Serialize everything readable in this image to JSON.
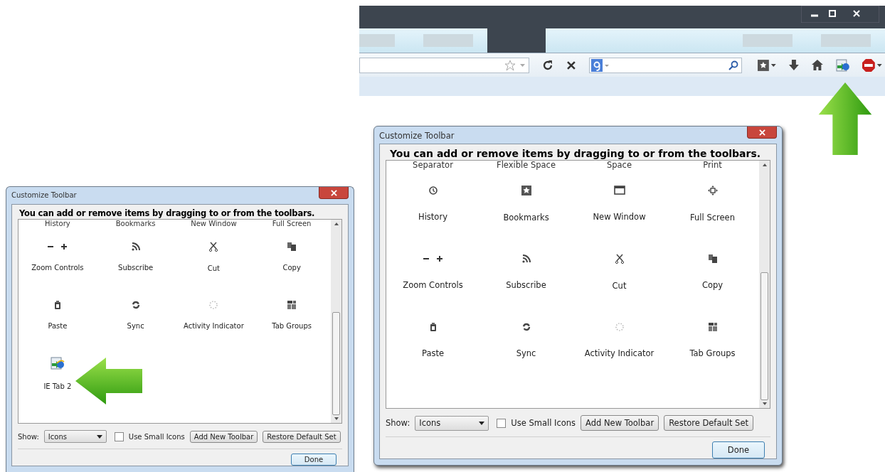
{
  "browser": {
    "tabs": [
      {
        "selected": false
      },
      {
        "selected": false
      },
      {
        "selected": true
      },
      {
        "selected": false
      },
      {
        "selected": false
      }
    ]
  },
  "dialogs": [
    {
      "title": "Customize Toolbar",
      "heading": "You can add or remove items by dragging to or from the toolbars.",
      "cut_row": [
        "History",
        "Bookmarks",
        "New Window",
        "Full Screen"
      ],
      "items": [
        {
          "label": "Zoom Controls"
        },
        {
          "label": "Subscribe"
        },
        {
          "label": "Cut"
        },
        {
          "label": "Copy"
        },
        {
          "label": "Paste"
        },
        {
          "label": "Sync"
        },
        {
          "label": "Activity Indicator"
        },
        {
          "label": "Tab Groups"
        },
        {
          "label": "IE Tab 2"
        }
      ],
      "show_label": "Show:",
      "show_value": "Icons",
      "small_icons": {
        "label": "Use Small Icons",
        "checked": false
      },
      "buttons": [
        "Add New Toolbar",
        "Restore Default Set"
      ],
      "done": "Done"
    },
    {
      "title": "Customize Toolbar",
      "heading": "You can add or remove items by dragging to or from the toolbars.",
      "cut_row": [
        "Separator",
        "Flexible Space",
        "Space",
        "Print"
      ],
      "items": [
        {
          "label": "History"
        },
        {
          "label": "Bookmarks"
        },
        {
          "label": "New Window"
        },
        {
          "label": "Full Screen"
        },
        {
          "label": "Zoom Controls"
        },
        {
          "label": "Subscribe"
        },
        {
          "label": "Cut"
        },
        {
          "label": "Copy"
        },
        {
          "label": "Paste"
        },
        {
          "label": "Sync"
        },
        {
          "label": "Activity Indicator"
        },
        {
          "label": "Tab Groups"
        }
      ],
      "show_label": "Show:",
      "show_value": "Icons",
      "small_icons": {
        "label": "Use Small Icons",
        "checked": false
      },
      "buttons": [
        "Add New Toolbar",
        "Restore Default Set"
      ],
      "done": "Done"
    }
  ]
}
